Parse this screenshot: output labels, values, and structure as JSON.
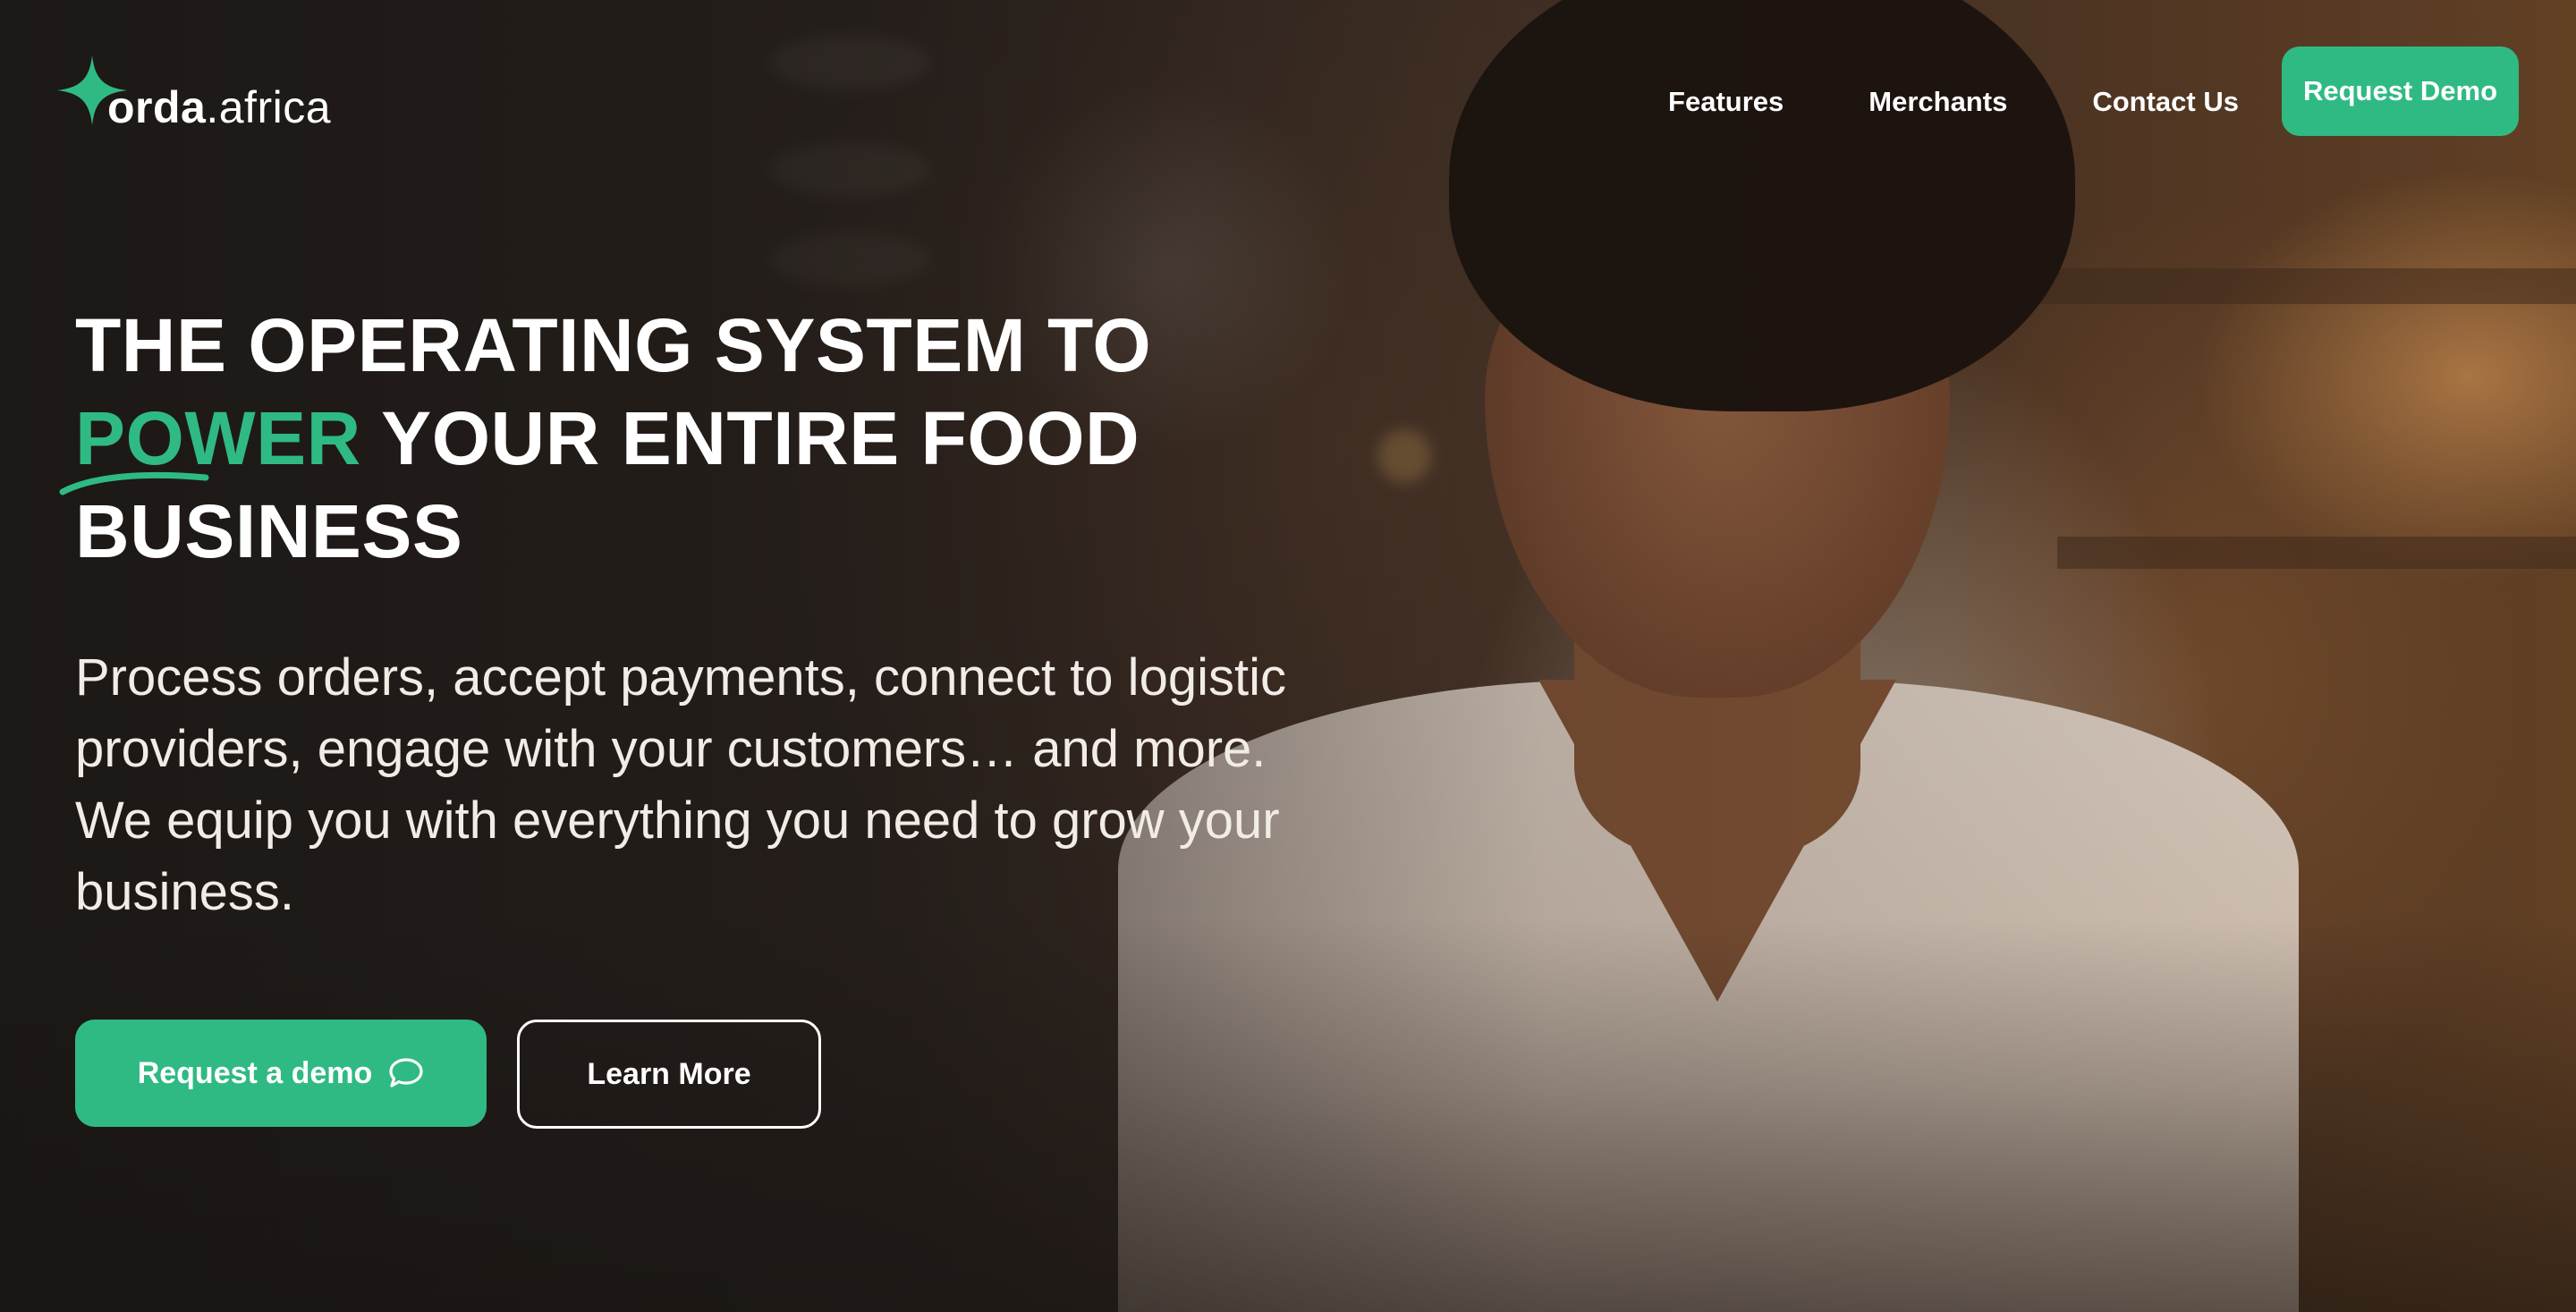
{
  "brand": {
    "name_bold": "orda",
    "name_light": ".africa",
    "accent_color": "#2fba84",
    "logo_icon": "sparkle-star-icon"
  },
  "nav": {
    "items": [
      {
        "label": "Features"
      },
      {
        "label": "Merchants"
      },
      {
        "label": "Contact Us"
      }
    ],
    "cta_label": "Request Demo"
  },
  "hero": {
    "headline_line1": "THE OPERATING SYSTEM TO",
    "headline_accent": "POWER",
    "headline_line2_rest": " YOUR ENTIRE FOOD",
    "headline_line3": "BUSINESS",
    "subtext": "Process orders, accept payments, connect to logistic providers, engage with your customers… and more. We equip you with everything you need to grow your business.",
    "primary_button": {
      "label": "Request a demo",
      "icon": "chat-bubble-icon"
    },
    "secondary_button": {
      "label": "Learn More"
    },
    "background_image": "woman-using-tablet-in-cafe-photo"
  }
}
